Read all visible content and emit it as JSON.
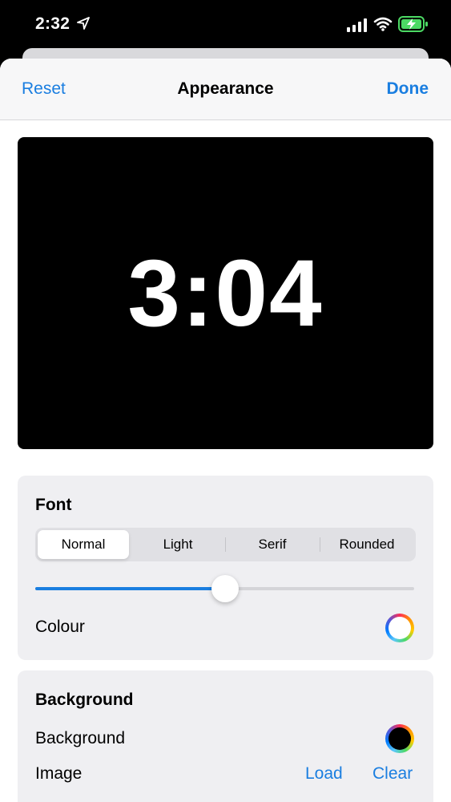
{
  "status_bar": {
    "time": "2:32"
  },
  "nav": {
    "reset_label": "Reset",
    "title": "Appearance",
    "done_label": "Done"
  },
  "preview": {
    "clock_text": "3:04"
  },
  "font_section": {
    "title": "Font",
    "segments": [
      "Normal",
      "Light",
      "Serif",
      "Rounded"
    ],
    "selected_segment": "Normal",
    "size_slider_fraction": 0.5,
    "colour_label": "Colour"
  },
  "background_section": {
    "title": "Background",
    "background_label": "Background",
    "image_label": "Image",
    "load_label": "Load",
    "clear_label": "Clear"
  },
  "colors": {
    "accent": "#1a7ee0",
    "font_colour": "#ffffff",
    "background_colour": "#000000"
  }
}
